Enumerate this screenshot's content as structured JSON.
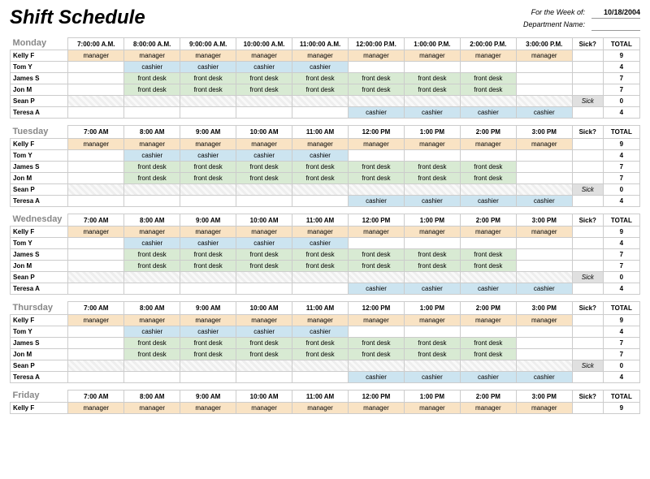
{
  "title": "Shift Schedule",
  "meta": {
    "week_label": "For the Week of:",
    "week_value": "10/18/2004",
    "dept_label": "Department Name:",
    "dept_value": ""
  },
  "sick_header": "Sick?",
  "total_header": "TOTAL",
  "sick_text": "Sick",
  "roles": {
    "manager": "manager",
    "cashier": "cashier",
    "frontdesk": "front desk"
  },
  "days": [
    {
      "name": "Monday",
      "times": [
        "7:00:00 A.M.",
        "8:00:00 A.M.",
        "9:00:00 A.M.",
        "10:00:00 A.M.",
        "11:00:00 A.M.",
        "12:00:00 P.M.",
        "1:00:00 P.M.",
        "2:00:00 P.M.",
        "3:00:00 P.M."
      ],
      "rows": [
        {
          "name": "Kelly F",
          "cells": [
            "manager",
            "manager",
            "manager",
            "manager",
            "manager",
            "manager",
            "manager",
            "manager",
            "manager"
          ],
          "sick": false,
          "total": 9
        },
        {
          "name": "Tom Y",
          "cells": [
            "",
            "cashier",
            "cashier",
            "cashier",
            "cashier",
            "",
            "",
            "",
            ""
          ],
          "sick": false,
          "total": 4
        },
        {
          "name": "James S",
          "cells": [
            "",
            "frontdesk",
            "frontdesk",
            "frontdesk",
            "frontdesk",
            "frontdesk",
            "frontdesk",
            "frontdesk",
            ""
          ],
          "sick": false,
          "total": 7
        },
        {
          "name": "Jon M",
          "cells": [
            "",
            "frontdesk",
            "frontdesk",
            "frontdesk",
            "frontdesk",
            "frontdesk",
            "frontdesk",
            "frontdesk",
            ""
          ],
          "sick": false,
          "total": 7
        },
        {
          "name": "Sean P",
          "cells": [
            "",
            "",
            "",
            "",
            "",
            "",
            "",
            "",
            ""
          ],
          "sick": true,
          "total": 0
        },
        {
          "name": "Teresa A",
          "cells": [
            "",
            "",
            "",
            "",
            "",
            "cashier",
            "cashier",
            "cashier",
            "cashier"
          ],
          "sick": false,
          "total": 4
        }
      ]
    },
    {
      "name": "Tuesday",
      "times": [
        "7:00 AM",
        "8:00 AM",
        "9:00 AM",
        "10:00 AM",
        "11:00 AM",
        "12:00 PM",
        "1:00 PM",
        "2:00 PM",
        "3:00 PM"
      ],
      "rows": [
        {
          "name": "Kelly F",
          "cells": [
            "manager",
            "manager",
            "manager",
            "manager",
            "manager",
            "manager",
            "manager",
            "manager",
            "manager"
          ],
          "sick": false,
          "total": 9
        },
        {
          "name": "Tom Y",
          "cells": [
            "",
            "cashier",
            "cashier",
            "cashier",
            "cashier",
            "",
            "",
            "",
            ""
          ],
          "sick": false,
          "total": 4
        },
        {
          "name": "James S",
          "cells": [
            "",
            "frontdesk",
            "frontdesk",
            "frontdesk",
            "frontdesk",
            "frontdesk",
            "frontdesk",
            "frontdesk",
            ""
          ],
          "sick": false,
          "total": 7
        },
        {
          "name": "Jon M",
          "cells": [
            "",
            "frontdesk",
            "frontdesk",
            "frontdesk",
            "frontdesk",
            "frontdesk",
            "frontdesk",
            "frontdesk",
            ""
          ],
          "sick": false,
          "total": 7
        },
        {
          "name": "Sean P",
          "cells": [
            "",
            "",
            "",
            "",
            "",
            "",
            "",
            "",
            ""
          ],
          "sick": true,
          "total": 0
        },
        {
          "name": "Teresa A",
          "cells": [
            "",
            "",
            "",
            "",
            "",
            "cashier",
            "cashier",
            "cashier",
            "cashier"
          ],
          "sick": false,
          "total": 4
        }
      ]
    },
    {
      "name": "Wednesday",
      "times": [
        "7:00 AM",
        "8:00 AM",
        "9:00 AM",
        "10:00 AM",
        "11:00 AM",
        "12:00 PM",
        "1:00 PM",
        "2:00 PM",
        "3:00 PM"
      ],
      "rows": [
        {
          "name": "Kelly F",
          "cells": [
            "manager",
            "manager",
            "manager",
            "manager",
            "manager",
            "manager",
            "manager",
            "manager",
            "manager"
          ],
          "sick": false,
          "total": 9
        },
        {
          "name": "Tom Y",
          "cells": [
            "",
            "cashier",
            "cashier",
            "cashier",
            "cashier",
            "",
            "",
            "",
            ""
          ],
          "sick": false,
          "total": 4
        },
        {
          "name": "James S",
          "cells": [
            "",
            "frontdesk",
            "frontdesk",
            "frontdesk",
            "frontdesk",
            "frontdesk",
            "frontdesk",
            "frontdesk",
            ""
          ],
          "sick": false,
          "total": 7
        },
        {
          "name": "Jon M",
          "cells": [
            "",
            "frontdesk",
            "frontdesk",
            "frontdesk",
            "frontdesk",
            "frontdesk",
            "frontdesk",
            "frontdesk",
            ""
          ],
          "sick": false,
          "total": 7
        },
        {
          "name": "Sean P",
          "cells": [
            "",
            "",
            "",
            "",
            "",
            "",
            "",
            "",
            ""
          ],
          "sick": true,
          "total": 0
        },
        {
          "name": "Teresa A",
          "cells": [
            "",
            "",
            "",
            "",
            "",
            "cashier",
            "cashier",
            "cashier",
            "cashier"
          ],
          "sick": false,
          "total": 4
        }
      ]
    },
    {
      "name": "Thursday",
      "times": [
        "7:00 AM",
        "8:00 AM",
        "9:00 AM",
        "10:00 AM",
        "11:00 AM",
        "12:00 PM",
        "1:00 PM",
        "2:00 PM",
        "3:00 PM"
      ],
      "rows": [
        {
          "name": "Kelly F",
          "cells": [
            "manager",
            "manager",
            "manager",
            "manager",
            "manager",
            "manager",
            "manager",
            "manager",
            "manager"
          ],
          "sick": false,
          "total": 9
        },
        {
          "name": "Tom Y",
          "cells": [
            "",
            "cashier",
            "cashier",
            "cashier",
            "cashier",
            "",
            "",
            "",
            ""
          ],
          "sick": false,
          "total": 4
        },
        {
          "name": "James S",
          "cells": [
            "",
            "frontdesk",
            "frontdesk",
            "frontdesk",
            "frontdesk",
            "frontdesk",
            "frontdesk",
            "frontdesk",
            ""
          ],
          "sick": false,
          "total": 7
        },
        {
          "name": "Jon M",
          "cells": [
            "",
            "frontdesk",
            "frontdesk",
            "frontdesk",
            "frontdesk",
            "frontdesk",
            "frontdesk",
            "frontdesk",
            ""
          ],
          "sick": false,
          "total": 7
        },
        {
          "name": "Sean P",
          "cells": [
            "",
            "",
            "",
            "",
            "",
            "",
            "",
            "",
            ""
          ],
          "sick": true,
          "total": 0
        },
        {
          "name": "Teresa A",
          "cells": [
            "",
            "",
            "",
            "",
            "",
            "cashier",
            "cashier",
            "cashier",
            "cashier"
          ],
          "sick": false,
          "total": 4
        }
      ]
    },
    {
      "name": "Friday",
      "times": [
        "7:00 AM",
        "8:00 AM",
        "9:00 AM",
        "10:00 AM",
        "11:00 AM",
        "12:00 PM",
        "1:00 PM",
        "2:00 PM",
        "3:00 PM"
      ],
      "rows": [
        {
          "name": "Kelly F",
          "cells": [
            "manager",
            "manager",
            "manager",
            "manager",
            "manager",
            "manager",
            "manager",
            "manager",
            "manager"
          ],
          "sick": false,
          "total": 9
        }
      ]
    }
  ]
}
